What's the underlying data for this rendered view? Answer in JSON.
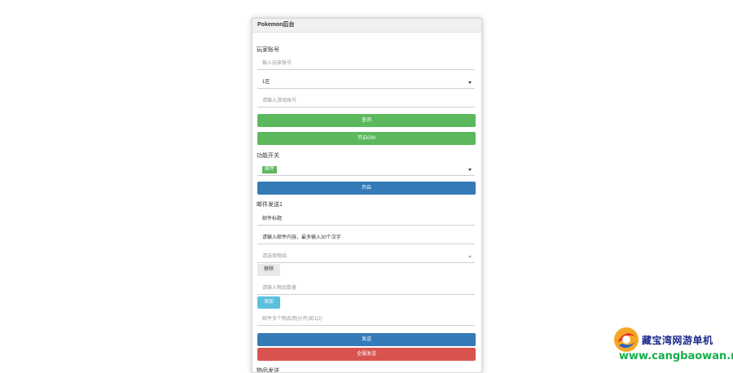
{
  "panel": {
    "title": "Pokemon后台"
  },
  "account": {
    "label": "玩家账号",
    "account_placeholder": "输入玩家账号",
    "server_select": "1区",
    "role_placeholder": "请输入游戏账号",
    "query_button": "查询",
    "gm_button": "开启GM"
  },
  "function_switch": {
    "label": "功能开关",
    "selected_tag": "邮件",
    "open_button": "开启"
  },
  "mail": {
    "label": "邮件发送1",
    "title_value": "邮件标题",
    "content_value": "请输入邮件内容，最多输入30个汉字",
    "item_select_placeholder": "请选择物品",
    "remove_button": "移除",
    "count_placeholder": "请输入物品数量",
    "add_button": "添加",
    "notice_placeholder": "邮件多个物品用|分开(如1|2)",
    "send_button": "发送",
    "send_all_button": "全服发送"
  },
  "next_section": {
    "label": "物品发送"
  },
  "watermark": {
    "title": "藏宝湾网游单机",
    "url": "www.cangbaowan.net"
  }
}
